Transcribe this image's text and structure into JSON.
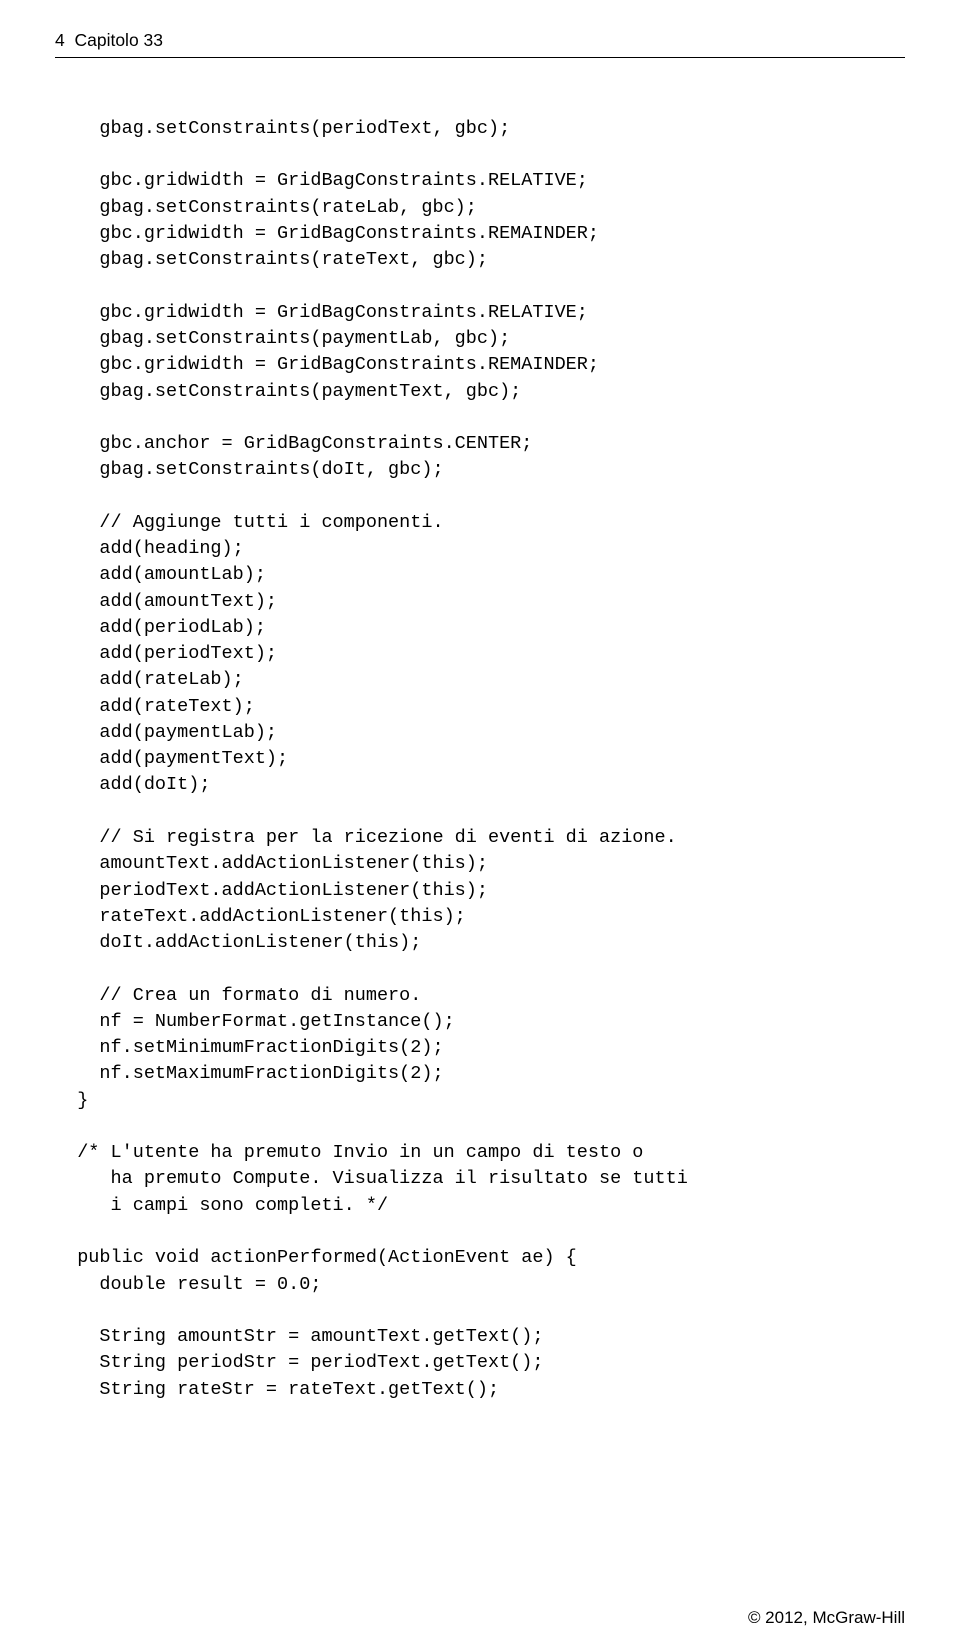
{
  "header": {
    "page": "4",
    "chapter": "Capitolo 33"
  },
  "code": "    gbag.setConstraints(periodText, gbc);\n\n    gbc.gridwidth = GridBagConstraints.RELATIVE;\n    gbag.setConstraints(rateLab, gbc);\n    gbc.gridwidth = GridBagConstraints.REMAINDER;\n    gbag.setConstraints(rateText, gbc);\n\n    gbc.gridwidth = GridBagConstraints.RELATIVE;\n    gbag.setConstraints(paymentLab, gbc);\n    gbc.gridwidth = GridBagConstraints.REMAINDER;\n    gbag.setConstraints(paymentText, gbc);\n\n    gbc.anchor = GridBagConstraints.CENTER;\n    gbag.setConstraints(doIt, gbc);\n\n    // Aggiunge tutti i componenti.\n    add(heading);\n    add(amountLab);\n    add(amountText);\n    add(periodLab);\n    add(periodText);\n    add(rateLab);\n    add(rateText);\n    add(paymentLab);\n    add(paymentText);\n    add(doIt);\n\n    // Si registra per la ricezione di eventi di azione.\n    amountText.addActionListener(this);\n    periodText.addActionListener(this);\n    rateText.addActionListener(this);\n    doIt.addActionListener(this);\n\n    // Crea un formato di numero.\n    nf = NumberFormat.getInstance();\n    nf.setMinimumFractionDigits(2);\n    nf.setMaximumFractionDigits(2);\n  }\n\n  /* L'utente ha premuto Invio in un campo di testo o\n     ha premuto Compute. Visualizza il risultato se tutti\n     i campi sono completi. */\n\n  public void actionPerformed(ActionEvent ae) {\n    double result = 0.0;\n\n    String amountStr = amountText.getText();\n    String periodStr = periodText.getText();\n    String rateStr = rateText.getText();",
  "footer": {
    "copyright": "© 2012, McGraw-Hill"
  }
}
